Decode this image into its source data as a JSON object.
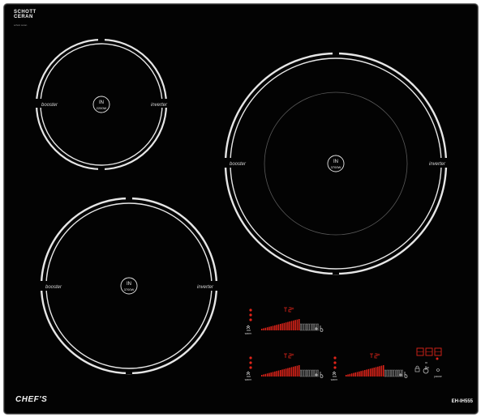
{
  "brand": {
    "top_logo_line1": "SCHOTT",
    "top_logo_line2": "CERAN",
    "top_logo_sub": "schott ceran",
    "bottom_logo": "CHEF'S",
    "model": "EH-IH555"
  },
  "zones": [
    {
      "id": "top-left",
      "left_label": "booster",
      "right_label": "inverter",
      "badge_title": "IN",
      "badge_power": "2200W"
    },
    {
      "id": "right",
      "left_label": "booster",
      "right_label": "inverter",
      "badge_title": "IN",
      "badge_power": "3700W"
    },
    {
      "id": "bottom-left",
      "left_label": "booster",
      "right_label": "inverter",
      "badge_title": "IN",
      "badge_power": "3700W"
    }
  ],
  "controls": {
    "warm_label": "warm",
    "pause_label": "pause",
    "timer_symbol": "⏲",
    "power_symbol": "⏻",
    "accent_color": "#e0241a",
    "outline_color": "#e6e6e6",
    "background_color": "#030303"
  }
}
